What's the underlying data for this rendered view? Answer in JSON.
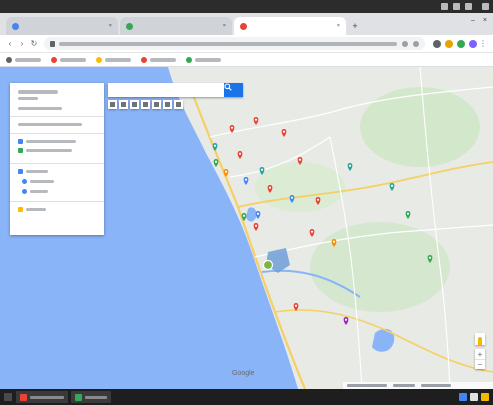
{
  "os_bar": {
    "title": "",
    "clock": ""
  },
  "tabs": [
    {
      "label": "",
      "favicon_color": "#4285f4",
      "active": false
    },
    {
      "label": "",
      "favicon_color": "#34a853",
      "active": false
    },
    {
      "label": "",
      "favicon_color": "#ea4335",
      "active": true
    }
  ],
  "omnibox": {
    "url": ""
  },
  "extension_colors": [
    "#5f6368",
    "#e8a300",
    "#34a853",
    "#7b61ff"
  ],
  "bookmarks": [
    {
      "favicon_color": "#5f6368"
    },
    {
      "favicon_color": "#ea4335"
    },
    {
      "favicon_color": "#fbbc04"
    },
    {
      "favicon_color": "#ea4335"
    },
    {
      "favicon_color": "#34a853"
    }
  ],
  "panel": {
    "rows": [
      "title",
      "subtitle",
      "meta",
      "layer-actions",
      "layer1-item1",
      "layer1-item2",
      "layer2-title",
      "layer2-item1",
      "layer2-item2",
      "base-map"
    ],
    "marker_colors": {
      "layer1": "#4285f4",
      "layer2": "#34a853",
      "basemap": "#fbbc04"
    }
  },
  "search": {
    "placeholder": "",
    "button_color": "#1a73e8"
  },
  "map": {
    "water_color": "#8ab4f8",
    "land_color": "#e8eae6",
    "road_major_color": "#f6cf65",
    "road_minor_color": "#ffffff",
    "green_color": "#cde6c3",
    "highlight_polygon_color": "#6f9fd8",
    "selected_marker_color": "#7cb342",
    "logo": "Google",
    "poi": [
      {
        "type": "red"
      },
      {
        "type": "red"
      },
      {
        "type": "red"
      },
      {
        "type": "red"
      },
      {
        "type": "red"
      },
      {
        "type": "red"
      },
      {
        "type": "red"
      },
      {
        "type": "red"
      },
      {
        "type": "red"
      },
      {
        "type": "red"
      },
      {
        "type": "teal"
      },
      {
        "type": "teal"
      },
      {
        "type": "teal"
      },
      {
        "type": "teal"
      },
      {
        "type": "green"
      },
      {
        "type": "green"
      },
      {
        "type": "green"
      },
      {
        "type": "green"
      },
      {
        "type": "blue"
      },
      {
        "type": "blue"
      },
      {
        "type": "blue"
      },
      {
        "type": "orange"
      },
      {
        "type": "orange"
      },
      {
        "type": "purple"
      }
    ],
    "poi_colors": {
      "red": "#ea4335",
      "teal": "#26a69a",
      "green": "#34a853",
      "blue": "#4285f4",
      "orange": "#fb8c00",
      "purple": "#9c27b0"
    }
  },
  "zoom": {
    "in": "+",
    "out": "−"
  },
  "taskbar": {
    "tasks": [
      {
        "favicon_color": "#ea4335"
      },
      {
        "favicon_color": "#34a853"
      }
    ],
    "tray_colors": [
      "#4285f4",
      "#e0e0e0",
      "#f5b800"
    ]
  }
}
